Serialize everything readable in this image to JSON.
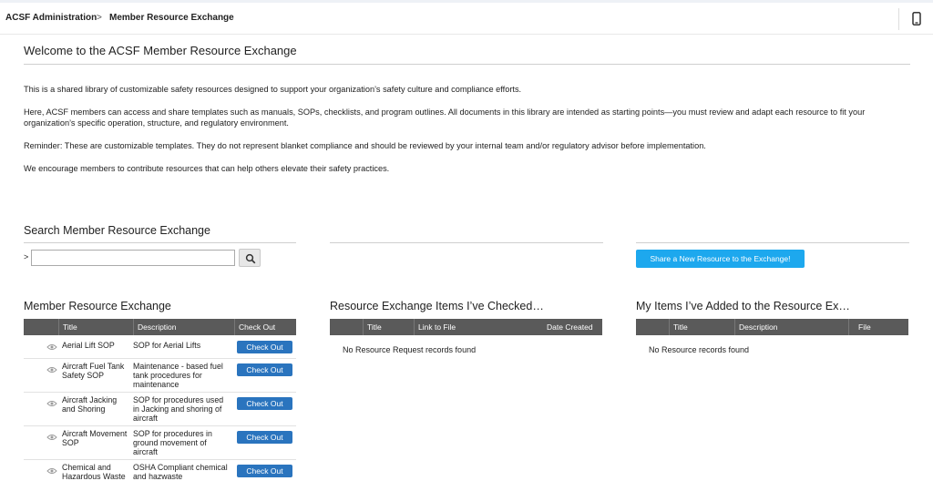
{
  "breadcrumb": {
    "root": "ACSF Administration",
    "separator": ">",
    "current": "Member Resource Exchange"
  },
  "welcome": {
    "title": "Welcome to the ACSF Member Resource Exchange",
    "p1": "This is a shared library of customizable safety resources designed to support your organization’s safety culture and compliance efforts.",
    "p2": "Here, ACSF members can access and share templates such as manuals, SOPs, checklists, and program outlines. All documents in this library are intended as starting points—you must review and adapt each resource to fit your organization’s specific operation, structure, and regulatory environment.",
    "p3": "Reminder: These are customizable templates. They do not represent blanket compliance and should be reviewed by your internal team and/or regulatory advisor before implementation.",
    "p4": "We encourage members to contribute resources that can help others elevate their safety practices."
  },
  "search": {
    "title": "Search Member Resource Exchange",
    "prompt": ">",
    "value": "",
    "placeholder": ""
  },
  "share_button": "Share a New Resource to the Exchange!",
  "exchange": {
    "title": "Member Resource Exchange",
    "columns": [
      "Title",
      "Description",
      "Check Out"
    ],
    "checkout_label": "Check Out",
    "rows": [
      {
        "title": "Aerial Lift SOP",
        "description": "SOP for Aerial Lifts"
      },
      {
        "title": "Aircraft Fuel Tank Safety SOP",
        "description": "Maintenance - based fuel tank procedures for maintenance"
      },
      {
        "title": "Aircraft Jacking and Shoring",
        "description": "SOP for procedures used in Jacking and shoring of aircraft"
      },
      {
        "title": "Aircraft Movement SOP",
        "description": "SOP for procedures in ground movement of aircraft"
      },
      {
        "title": "Chemical and Hazardous Waste",
        "description": "OSHA Compliant chemical and hazwaste"
      }
    ]
  },
  "checked": {
    "title": "Resource Exchange Items I’ve Checked…",
    "columns": [
      "Title",
      "Link to File",
      "Date Created"
    ],
    "empty": "No Resource Request records found"
  },
  "added": {
    "title": "My Items I’ve Added to the Resource Ex…",
    "columns": [
      "Title",
      "Description",
      "File"
    ],
    "empty": "No Resource records found"
  },
  "icons": {
    "device": "mobile-phone-icon",
    "search": "magnifier-icon",
    "row_view": "eye-icon"
  },
  "colors": {
    "header_bg": "#5a5a5a",
    "checkout_button": "#2a74be",
    "share_button": "#1da8ee"
  }
}
